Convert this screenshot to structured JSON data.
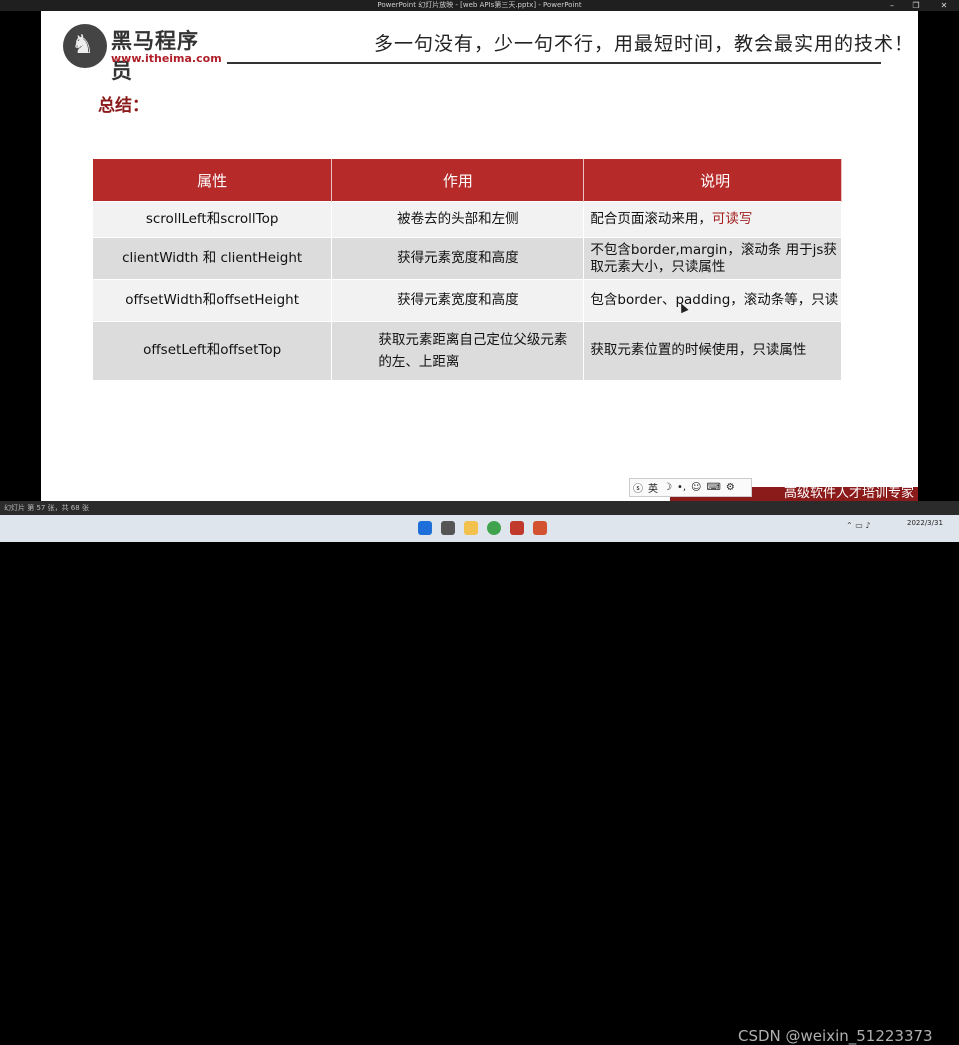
{
  "window": {
    "title": "PowerPoint 幻灯片放映 - [web APIs第三天.pptx] - PowerPoint"
  },
  "slide": {
    "logo_cn": "黑马程序员",
    "logo_url": "www.itheima.com",
    "slogan": "多一句没有，少一句不行，用最短时间，教会最实用的技术！",
    "heading": "总结：",
    "table": {
      "headers": [
        "属性",
        "作用",
        "说明"
      ],
      "rows": [
        {
          "prop": "scrollLeft和scrollTop",
          "use": "被卷去的头部和左侧",
          "desc_a": "配合页面滚动来用，",
          "desc_b": "可读写"
        },
        {
          "prop": "clientWidth 和 clientHeight",
          "use": "获得元素宽度和高度",
          "desc": "不包含border,margin，滚动条 用于js获取元素大小，只读属性"
        },
        {
          "prop": "offsetWidth和offsetHeight",
          "use": "获得元素宽度和高度",
          "desc": "包含border、padding，滚动条等，只读"
        },
        {
          "prop": "offsetLeft和offsetTop",
          "use": "获取元素距离自己定位父级元素的左、上距离",
          "desc": "获取元素位置的时候使用，只读属性"
        }
      ]
    },
    "badge": "高级软件人才培训专家"
  },
  "ime": {
    "lang": "英"
  },
  "status": {
    "slide_info": "幻灯片 第 57 张，共 68 张"
  },
  "taskbar": {
    "watermark": "CSDN @weixin_51223373",
    "date": "2022/3/31"
  },
  "colors": {
    "header_red": "#b72a2a",
    "accent_red": "#a31f1f",
    "logo_red": "#b0202a"
  }
}
